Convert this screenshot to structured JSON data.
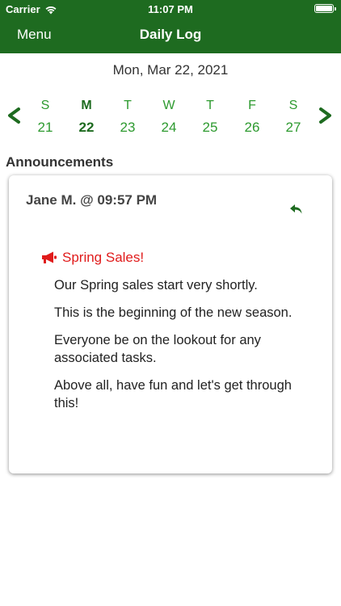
{
  "status_bar": {
    "carrier": "Carrier",
    "time": "11:07 PM"
  },
  "nav": {
    "menu_label": "Menu",
    "title": "Daily Log"
  },
  "date_label": "Mon, Mar 22, 2021",
  "week": {
    "days": [
      {
        "dow": "S",
        "num": "21"
      },
      {
        "dow": "M",
        "num": "22"
      },
      {
        "dow": "T",
        "num": "23"
      },
      {
        "dow": "W",
        "num": "24"
      },
      {
        "dow": "T",
        "num": "25"
      },
      {
        "dow": "F",
        "num": "26"
      },
      {
        "dow": "S",
        "num": "27"
      }
    ],
    "selected_index": 1,
    "prev_icon": "chevron-left-icon",
    "next_icon": "chevron-right-icon"
  },
  "announcements": {
    "section_title": "Announcements",
    "items": [
      {
        "author_line": "Jane M. @ 09:57 PM",
        "headline": "Spring Sales!",
        "headline_icon": "megaphone-icon",
        "reply_icon": "reply-icon",
        "paragraphs": [
          "Our Spring sales start very shortly.",
          "This is the beginning of the new season.",
          "Everyone be on the lookout for any associated tasks.",
          "Above all, have fun and let's get through this!"
        ]
      }
    ]
  },
  "colors": {
    "brand_green": "#1e6b20",
    "day_green": "#2d9a2f",
    "headline_red": "#e01b1b"
  }
}
